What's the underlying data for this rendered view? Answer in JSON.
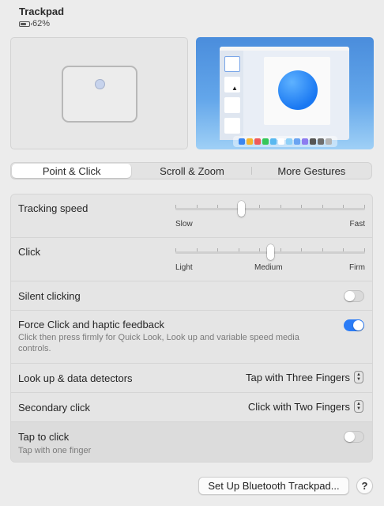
{
  "header": {
    "title": "Trackpad",
    "battery_text": "62%",
    "battery_level": 0.62
  },
  "tabs": [
    {
      "label": "Point & Click",
      "selected": true
    },
    {
      "label": "Scroll & Zoom",
      "selected": false
    },
    {
      "label": "More Gestures",
      "selected": false
    }
  ],
  "settings": {
    "tracking_speed": {
      "label": "Tracking speed",
      "min_label": "Slow",
      "max_label": "Fast",
      "value_fraction": 0.34
    },
    "click": {
      "label": "Click",
      "left_label": "Light",
      "mid_label": "Medium",
      "right_label": "Firm",
      "value_fraction": 0.5
    },
    "silent_clicking": {
      "label": "Silent clicking",
      "enabled": false
    },
    "force_click": {
      "label": "Force Click and haptic feedback",
      "description": "Click then press firmly for Quick Look, Look up and variable speed media controls.",
      "enabled": true
    },
    "look_up": {
      "label": "Look up & data detectors",
      "value": "Tap with Three Fingers"
    },
    "secondary_click": {
      "label": "Secondary click",
      "value": "Click with Two Fingers"
    },
    "tap_to_click": {
      "label": "Tap to click",
      "description": "Tap with one finger",
      "enabled": false
    }
  },
  "footer": {
    "setup_button_label": "Set Up Bluetooth Trackpad...",
    "help_label": "?"
  },
  "colors": {
    "accent": "#2b7cf6",
    "dock_icons": [
      "#3a86f0",
      "#f5b52e",
      "#ef5a5a",
      "#34c759",
      "#58b8f0",
      "#ffffff",
      "#8ed0f8",
      "#6aa4f2",
      "#8c7cf0",
      "#555555",
      "#6e6e6e",
      "#b4b4b4"
    ]
  }
}
